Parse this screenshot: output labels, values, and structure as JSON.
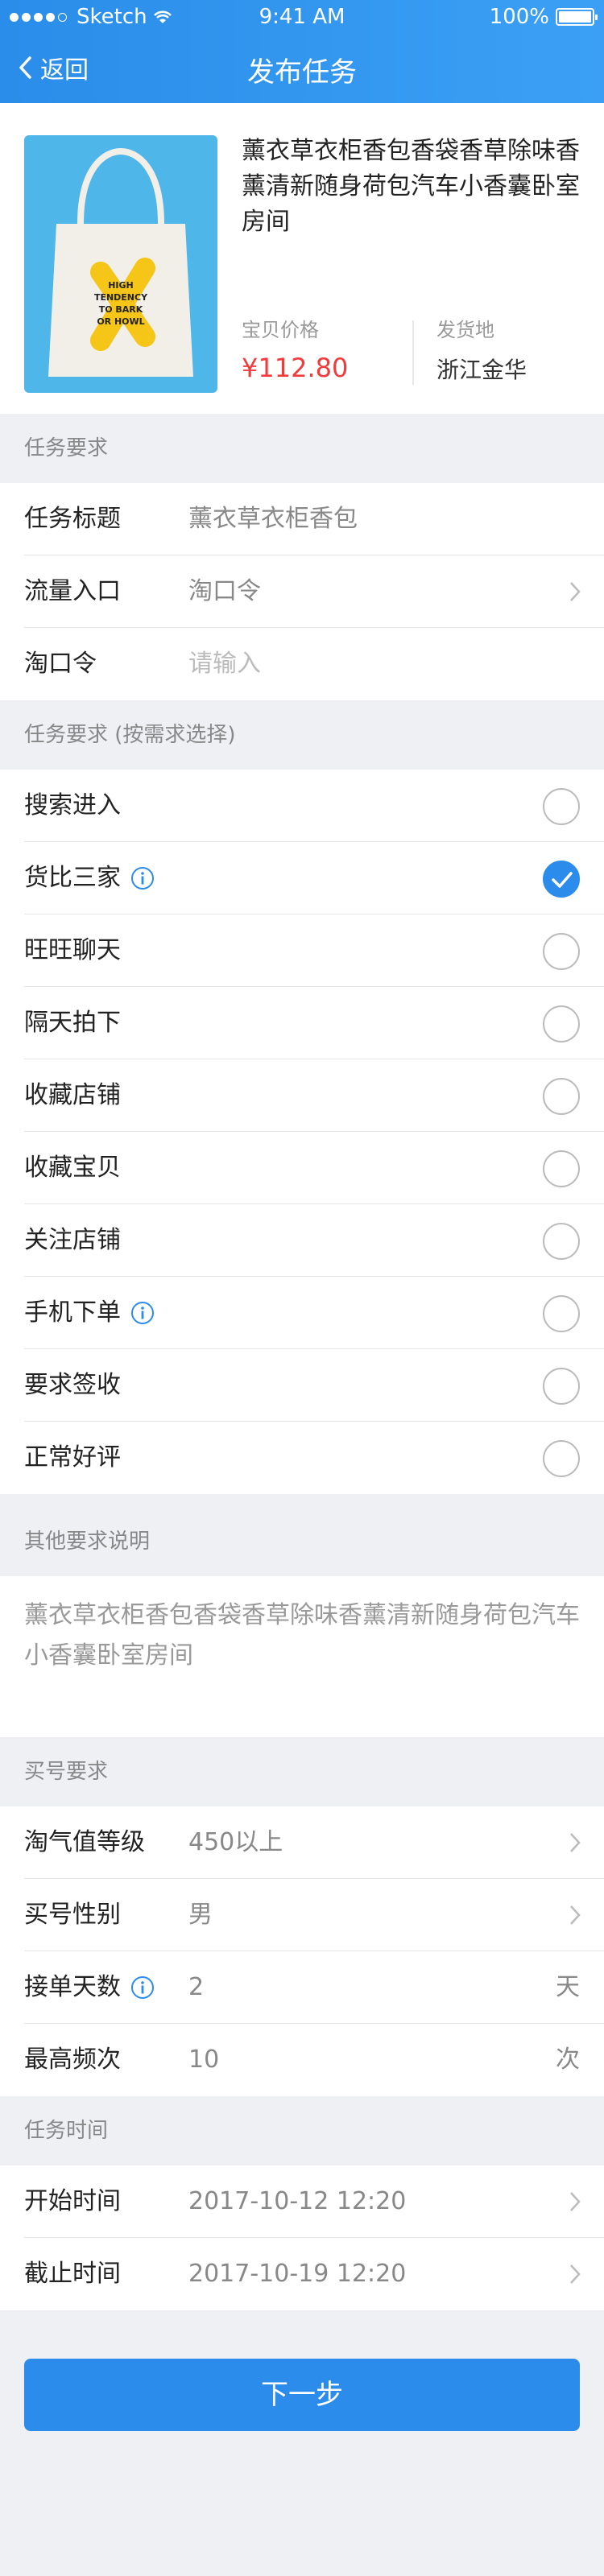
{
  "status_bar": {
    "carrier": "Sketch",
    "time": "9:41 AM",
    "battery": "100%"
  },
  "nav": {
    "back_label": "返回",
    "title": "发布任务"
  },
  "product": {
    "name": "薰衣草衣柜香包香袋香草除味香薰清新随身荷包汽车小香囊卧室房间",
    "image_text": [
      "HIGH",
      "TENDENCY",
      "TO BARK",
      "OR HOWL"
    ],
    "price_label": "宝贝价格",
    "price": "¥112.80",
    "origin_label": "发货地",
    "origin": "浙江金华"
  },
  "task_requirements": {
    "header": "任务要求",
    "rows": [
      {
        "label": "任务标题",
        "value": "薰衣草衣柜香包"
      },
      {
        "label": "流量入口",
        "value": "淘口令"
      },
      {
        "label": "淘口令",
        "placeholder": "请输入"
      }
    ]
  },
  "optional_requirements": {
    "header": "任务要求 (按需求选择)",
    "items": [
      {
        "label": "搜索进入",
        "checked": false,
        "info": false
      },
      {
        "label": "货比三家",
        "checked": true,
        "info": true
      },
      {
        "label": "旺旺聊天",
        "checked": false,
        "info": false
      },
      {
        "label": "隔天拍下",
        "checked": false,
        "info": false
      },
      {
        "label": "收藏店铺",
        "checked": false,
        "info": false
      },
      {
        "label": "收藏宝贝",
        "checked": false,
        "info": false
      },
      {
        "label": "关注店铺",
        "checked": false,
        "info": false
      },
      {
        "label": "手机下单",
        "checked": false,
        "info": true
      },
      {
        "label": "要求签收",
        "checked": false,
        "info": false
      },
      {
        "label": "正常好评",
        "checked": false,
        "info": false
      }
    ]
  },
  "other_requirements": {
    "header": "其他要求说明",
    "text": "薰衣草衣柜香包香袋香草除味香薰清新随身荷包汽车小香囊卧室房间"
  },
  "buyer_requirements": {
    "header": "买号要求",
    "rows": [
      {
        "label": "淘气值等级",
        "value": "450以上"
      },
      {
        "label": "买号性别",
        "value": "男"
      },
      {
        "label": "接单天数",
        "value": "2",
        "unit": "天"
      },
      {
        "label": "最高频次",
        "value": "10",
        "unit": "次"
      }
    ]
  },
  "task_time": {
    "header": "任务时间",
    "rows": [
      {
        "label": "开始时间",
        "value": "2017-10-12 12:20"
      },
      {
        "label": "截止时间",
        "value": "2017-10-19 12:20"
      }
    ]
  },
  "next_button": "下一步",
  "colors": {
    "accent": "#2b8ceb",
    "price": "#f23b3b",
    "background": "#eef0f4"
  }
}
